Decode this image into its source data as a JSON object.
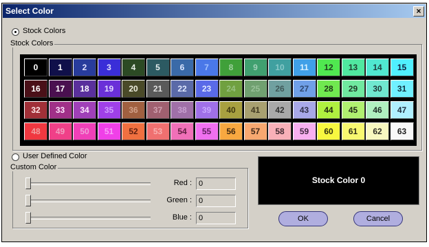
{
  "window": {
    "title": "Select Color",
    "close_glyph": "×"
  },
  "stock": {
    "radio_label": "Stock Colors",
    "group_label": "Stock Colors",
    "selected": true,
    "cells": [
      {
        "n": "0",
        "bg": "#000000",
        "fg": "#ffffff"
      },
      {
        "n": "1",
        "bg": "#10104a",
        "fg": "#ffffff"
      },
      {
        "n": "2",
        "bg": "#283c9c",
        "fg": "#e0e0ff"
      },
      {
        "n": "3",
        "bg": "#3a2ed8",
        "fg": "#e0e0ff"
      },
      {
        "n": "4",
        "bg": "#2c4a24",
        "fg": "#e8f0e8"
      },
      {
        "n": "5",
        "bg": "#2c5a62",
        "fg": "#e8f0f0"
      },
      {
        "n": "6",
        "bg": "#3a6aa8",
        "fg": "#dde8ff"
      },
      {
        "n": "7",
        "bg": "#4a78e8",
        "fg": "#a0c0ff"
      },
      {
        "n": "8",
        "bg": "#40a03a",
        "fg": "#a0d0a0"
      },
      {
        "n": "9",
        "bg": "#40a070",
        "fg": "#a0d0b8"
      },
      {
        "n": "10",
        "bg": "#40a0a0",
        "fg": "#88c8c8"
      },
      {
        "n": "11",
        "bg": "#40a0e8",
        "fg": "#d8f0ff"
      },
      {
        "n": "12",
        "bg": "#50e850",
        "fg": "#204020"
      },
      {
        "n": "13",
        "bg": "#50e8a0",
        "fg": "#204030"
      },
      {
        "n": "14",
        "bg": "#50e8d0",
        "fg": "#204040"
      },
      {
        "n": "15",
        "bg": "#50f0ff",
        "fg": "#102040"
      },
      {
        "n": "16",
        "bg": "#4a1018",
        "fg": "#ffffff"
      },
      {
        "n": "17",
        "bg": "#4a1050",
        "fg": "#ffffff"
      },
      {
        "n": "18",
        "bg": "#5a309c",
        "fg": "#ffffff"
      },
      {
        "n": "19",
        "bg": "#6a30d8",
        "fg": "#e0d8ff"
      },
      {
        "n": "20",
        "bg": "#4a4a28",
        "fg": "#f0f0e0"
      },
      {
        "n": "21",
        "bg": "#5a5a5a",
        "fg": "#e0e0e0"
      },
      {
        "n": "22",
        "bg": "#5a6aa8",
        "fg": "#e0e8ff"
      },
      {
        "n": "23",
        "bg": "#5a6ae8",
        "fg": "#e0e8ff"
      },
      {
        "n": "24",
        "bg": "#70a040",
        "fg": "#98c080"
      },
      {
        "n": "25",
        "bg": "#70a070",
        "fg": "#98c098"
      },
      {
        "n": "26",
        "bg": "#70a0a0",
        "fg": "#405858"
      },
      {
        "n": "27",
        "bg": "#70a0e8",
        "fg": "#304870"
      },
      {
        "n": "28",
        "bg": "#70e850",
        "fg": "#203818"
      },
      {
        "n": "29",
        "bg": "#70e8a0",
        "fg": "#203828"
      },
      {
        "n": "30",
        "bg": "#70e8d0",
        "fg": "#203838"
      },
      {
        "n": "31",
        "bg": "#70f0ff",
        "fg": "#103040"
      },
      {
        "n": "32",
        "bg": "#a03038",
        "fg": "#ffe8e8"
      },
      {
        "n": "33",
        "bg": "#a03088",
        "fg": "#ffe8ff"
      },
      {
        "n": "34",
        "bg": "#a040b8",
        "fg": "#ffe8ff"
      },
      {
        "n": "35",
        "bg": "#a040e8",
        "fg": "#d0a0ff"
      },
      {
        "n": "36",
        "bg": "#a06040",
        "fg": "#d0a088"
      },
      {
        "n": "37",
        "bg": "#a06070",
        "fg": "#d0a0b0"
      },
      {
        "n": "38",
        "bg": "#a070a8",
        "fg": "#c8a0d0"
      },
      {
        "n": "39",
        "bg": "#a070e8",
        "fg": "#c8a8ff"
      },
      {
        "n": "40",
        "bg": "#a8a040",
        "fg": "#403810"
      },
      {
        "n": "41",
        "bg": "#a8a070",
        "fg": "#403820"
      },
      {
        "n": "42",
        "bg": "#a8a8a8",
        "fg": "#303030"
      },
      {
        "n": "43",
        "bg": "#a8a8e8",
        "fg": "#303048"
      },
      {
        "n": "44",
        "bg": "#b0f040",
        "fg": "#202810"
      },
      {
        "n": "45",
        "bg": "#b0f070",
        "fg": "#202818"
      },
      {
        "n": "46",
        "bg": "#b0f0c0",
        "fg": "#203028"
      },
      {
        "n": "47",
        "bg": "#b0f0ff",
        "fg": "#203040"
      },
      {
        "n": "48",
        "bg": "#f03840",
        "fg": "#f0a0a0"
      },
      {
        "n": "49",
        "bg": "#f04088",
        "fg": "#f0a0c0"
      },
      {
        "n": "50",
        "bg": "#f040b8",
        "fg": "#f0a0d8"
      },
      {
        "n": "51",
        "bg": "#f040e8",
        "fg": "#f8a0f8"
      },
      {
        "n": "52",
        "bg": "#f07040",
        "fg": "#602010"
      },
      {
        "n": "53",
        "bg": "#f07070",
        "fg": "#f8b0b0"
      },
      {
        "n": "54",
        "bg": "#f070b8",
        "fg": "#602040"
      },
      {
        "n": "55",
        "bg": "#f070f0",
        "fg": "#602060"
      },
      {
        "n": "56",
        "bg": "#f8a840",
        "fg": "#402810"
      },
      {
        "n": "57",
        "bg": "#f8a870",
        "fg": "#402818"
      },
      {
        "n": "58",
        "bg": "#f8b0b8",
        "fg": "#402830"
      },
      {
        "n": "59",
        "bg": "#f8b0f0",
        "fg": "#402840"
      },
      {
        "n": "60",
        "bg": "#f8f840",
        "fg": "#303010"
      },
      {
        "n": "61",
        "bg": "#f8f870",
        "fg": "#303018"
      },
      {
        "n": "62",
        "bg": "#f8f8c0",
        "fg": "#303028"
      },
      {
        "n": "63",
        "bg": "#f8f8f8",
        "fg": "#202020"
      }
    ]
  },
  "user": {
    "radio_label": "User Defined Color",
    "group_label": "Custom Color",
    "selected": false,
    "sliders": [
      {
        "key": "red",
        "label": "Red :",
        "value": "0",
        "level": 0
      },
      {
        "key": "green",
        "label": "Green :",
        "value": "0",
        "level": 0
      },
      {
        "key": "blue",
        "label": "Blue :",
        "value": "0",
        "level": 0
      }
    ]
  },
  "preview": {
    "text": "Stock Color 0",
    "color": "#000000"
  },
  "buttons": {
    "ok": "OK",
    "cancel": "Cancel"
  },
  "colors": {
    "dialog_face": "#d4d0c8",
    "title_start": "#0a246a",
    "title_end": "#a6caf0",
    "button_fill": "#b0aedf"
  }
}
